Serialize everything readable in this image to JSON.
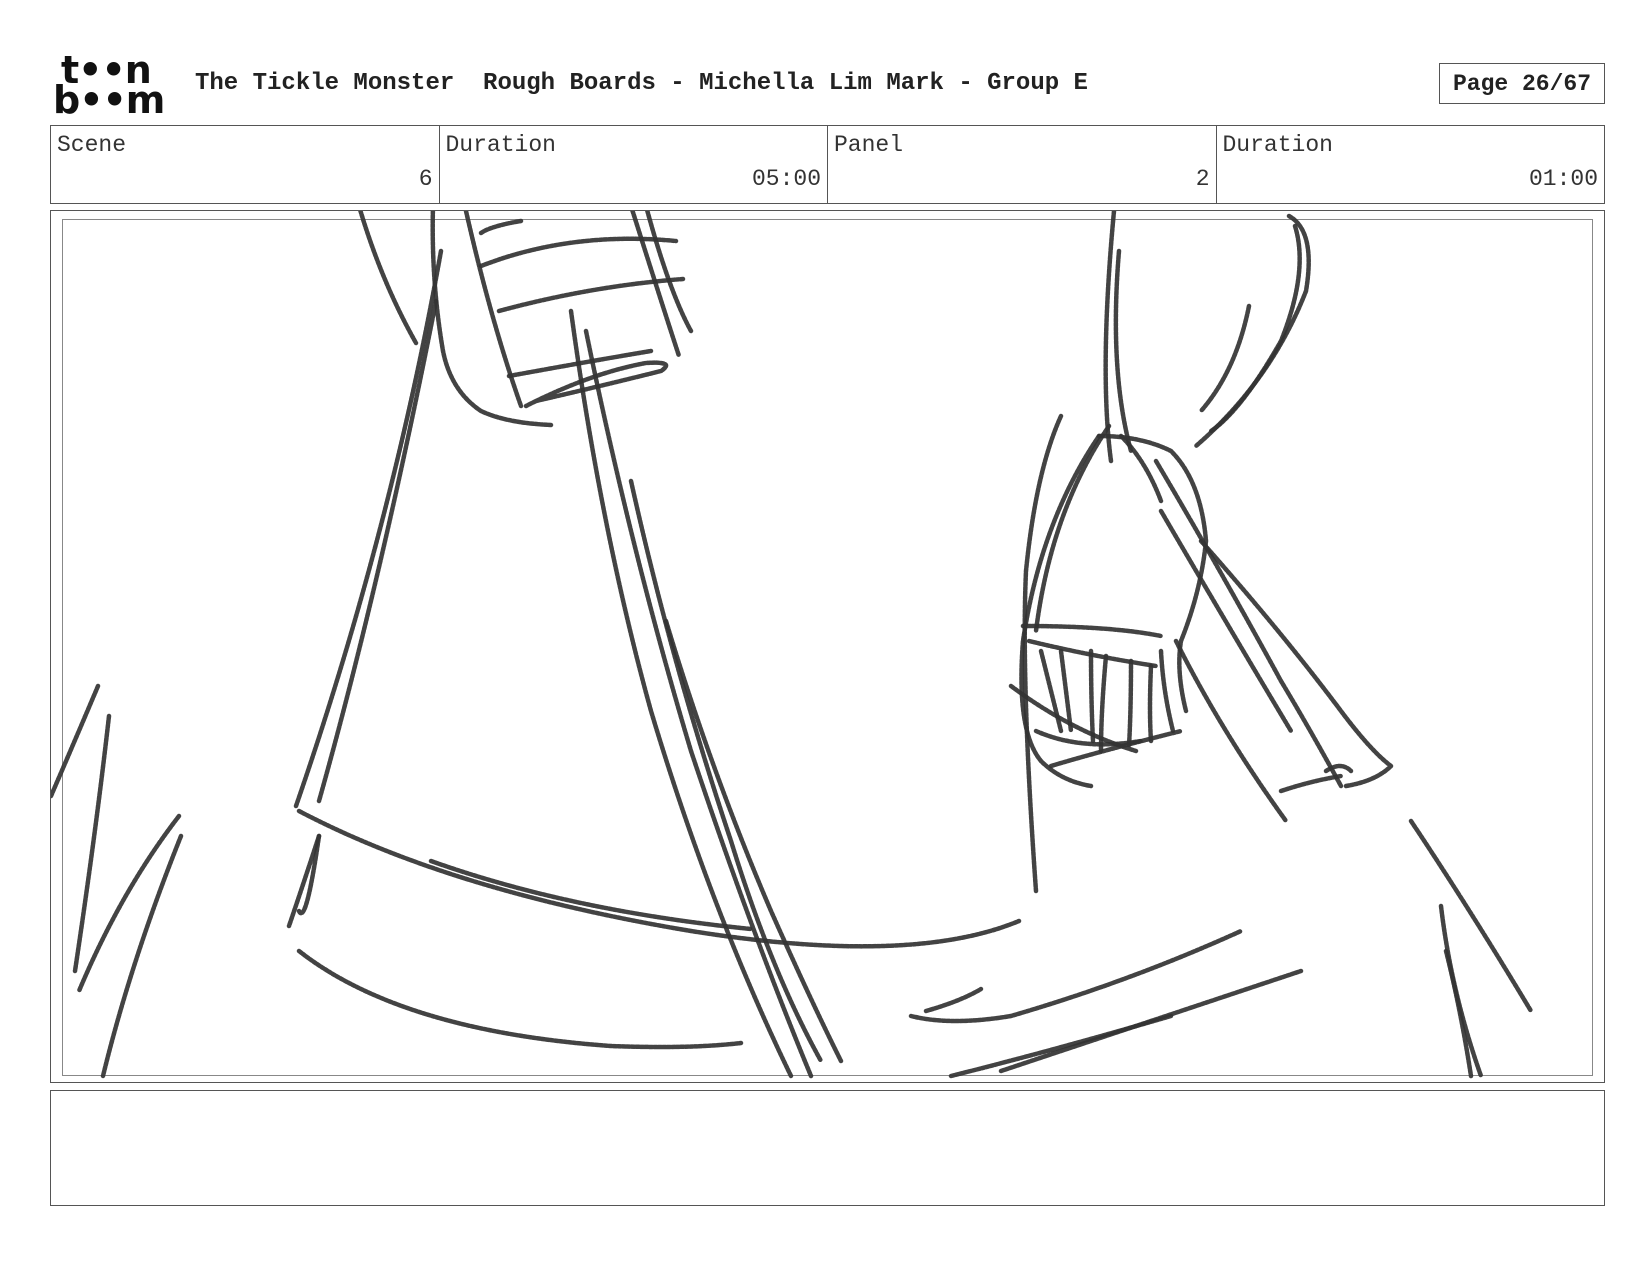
{
  "logo": {
    "line1": "t••n",
    "line2": "b••m"
  },
  "header": {
    "title": "The Tickle Monster  Rough Boards - Michella Lim Mark - Group E",
    "page": "Page 26/67"
  },
  "info": {
    "scene_label": "Scene",
    "scene_value": "6",
    "scene_duration_label": "Duration",
    "scene_duration_value": "05:00",
    "panel_label": "Panel",
    "panel_value": "2",
    "panel_duration_label": "Duration",
    "panel_duration_value": "01:00"
  },
  "notes": {
    "text": ""
  }
}
